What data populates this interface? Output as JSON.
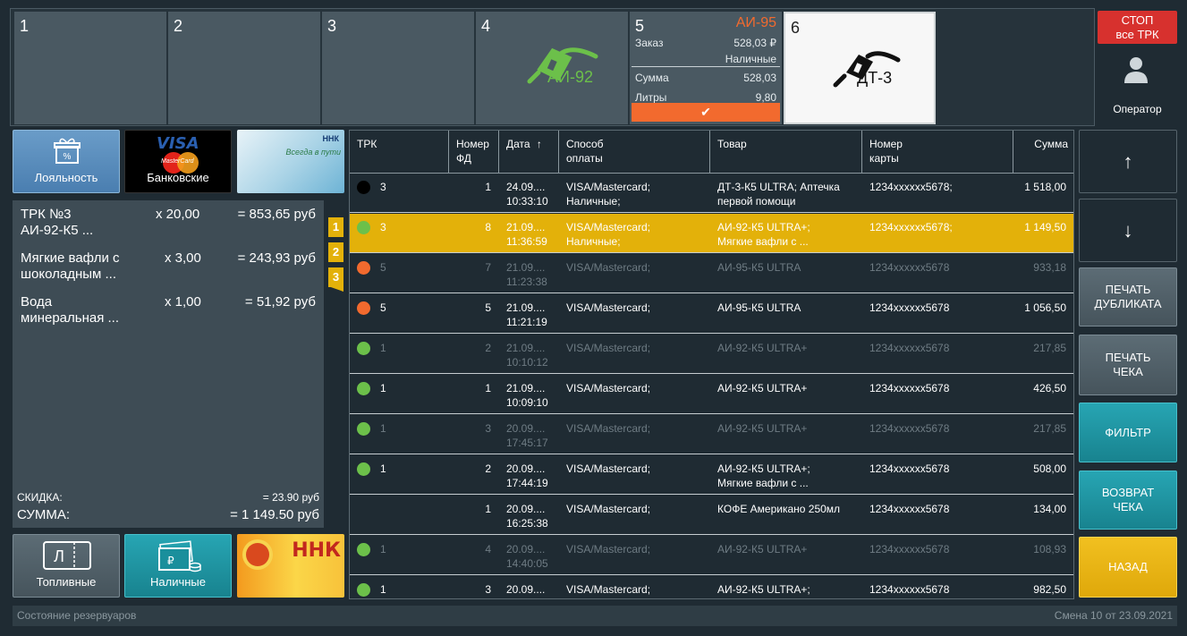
{
  "pumps": [
    {
      "num": "1"
    },
    {
      "num": "2"
    },
    {
      "num": "3"
    },
    {
      "num": "4",
      "fuel": "АИ-92"
    },
    {
      "num": "5",
      "fuel": "АИ-95",
      "order_label": "Заказ",
      "order_value": "528,03 ₽",
      "payment": "Наличные",
      "sum_label": "Сумма",
      "sum_value": "528,03",
      "liters_label": "Литры",
      "liters_value": "9,80",
      "ok": "✔"
    },
    {
      "num": "6",
      "fuel": "ДТ-3"
    }
  ],
  "stop_button": {
    "line1": "СТОП",
    "line2": "все ТРК"
  },
  "operator_label": "Оператор",
  "tiles": {
    "loyalty": "Лояльность",
    "bank": "Банковские",
    "bank_visa": "VISA",
    "bank_mc": "MasterCard",
    "fuel_cards": "Топливные",
    "cash": "Наличные",
    "nnk_brand": "ННК",
    "nnk_slogan": "Всегда в пути"
  },
  "order": {
    "items": [
      {
        "name1": "ТРК №3",
        "name2": "АИ-92-К5 ...",
        "qty": "x 20,00",
        "sum": "= 853,65 руб"
      },
      {
        "name1": "Мягкие вафли с",
        "name2": "шоколадным ...",
        "qty": "x 3,00",
        "sum": "= 243,93 руб"
      },
      {
        "name1": "Вода",
        "name2": "минеральная ...",
        "qty": "x 1,00",
        "sum": "= 51,92 руб"
      }
    ],
    "discount_label": "СКИДКА:",
    "discount_value": "= 23.90 руб",
    "total_label": "СУММА:",
    "total_value": "= 1 149.50 руб",
    "tags": [
      "1",
      "2",
      "3"
    ]
  },
  "table": {
    "headers": {
      "trk": "ТРК",
      "fd1": "Номер",
      "fd2": "ФД",
      "date": "Дата",
      "sort_icon": "↑",
      "pay1": "Способ",
      "pay2": "оплаты",
      "goods": "Товар",
      "card1": "Номер",
      "card2": "карты",
      "sum": "Сумма"
    },
    "rows": [
      {
        "dot": "black",
        "trk": "3",
        "fd": "1",
        "d1": "24.09....",
        "d2": "10:33:10",
        "p1": "VISA/Mastercard;",
        "p2": "Наличные;",
        "g1": "ДТ-3-К5 ULTRA; Аптечка",
        "g2": "первой помощи",
        "card": "1234xxxxxx5678;",
        "sum": "1 518,00",
        "state": "normal"
      },
      {
        "dot": "green",
        "trk": "3",
        "fd": "8",
        "d1": "21.09....",
        "d2": "11:36:59",
        "p1": "VISA/Mastercard;",
        "p2": "Наличные;",
        "g1": "АИ-92-К5 ULTRA+;",
        "g2": "Мягкие вафли с ...",
        "card": "1234xxxxxx5678;",
        "sum": "1 149,50",
        "state": "sel"
      },
      {
        "dot": "orange",
        "trk": "5",
        "fd": "7",
        "d1": "21.09....",
        "d2": "11:23:38",
        "p1": "VISA/Mastercard;",
        "p2": "",
        "g1": "АИ-95-К5 ULTRA",
        "g2": "",
        "card": "1234xxxxxx5678",
        "sum": "933,18",
        "state": "dim"
      },
      {
        "dot": "orange",
        "trk": "5",
        "fd": "5",
        "d1": "21.09....",
        "d2": "11:21:19",
        "p1": "VISA/Mastercard;",
        "p2": "",
        "g1": "АИ-95-К5 ULTRA",
        "g2": "",
        "card": "1234xxxxxx5678",
        "sum": "1 056,50",
        "state": "normal"
      },
      {
        "dot": "green",
        "trk": "1",
        "fd": "2",
        "d1": "21.09....",
        "d2": "10:10:12",
        "p1": "VISA/Mastercard;",
        "p2": "",
        "g1": "АИ-92-К5 ULTRA+",
        "g2": "",
        "card": "1234xxxxxx5678",
        "sum": "217,85",
        "state": "dim"
      },
      {
        "dot": "green",
        "trk": "1",
        "fd": "1",
        "d1": "21.09....",
        "d2": "10:09:10",
        "p1": "VISA/Mastercard;",
        "p2": "",
        "g1": "АИ-92-К5 ULTRA+",
        "g2": "",
        "card": "1234xxxxxx5678",
        "sum": "426,50",
        "state": "normal"
      },
      {
        "dot": "green",
        "trk": "1",
        "fd": "3",
        "d1": "20.09....",
        "d2": "17:45:17",
        "p1": "VISA/Mastercard;",
        "p2": "",
        "g1": "АИ-92-К5 ULTRA+",
        "g2": "",
        "card": "1234xxxxxx5678",
        "sum": "217,85",
        "state": "dim"
      },
      {
        "dot": "green",
        "trk": "1",
        "fd": "2",
        "d1": "20.09....",
        "d2": "17:44:19",
        "p1": "VISA/Mastercard;",
        "p2": "",
        "g1": "АИ-92-К5 ULTRA+;",
        "g2": "Мягкие вафли с ...",
        "card": "1234xxxxxx5678",
        "sum": "508,00",
        "state": "normal"
      },
      {
        "dot": "",
        "trk": "",
        "fd": "1",
        "d1": "20.09....",
        "d2": "16:25:38",
        "p1": "VISA/Mastercard;",
        "p2": "",
        "g1": "КОФЕ Американо 250мл",
        "g2": "",
        "card": "1234xxxxxx5678",
        "sum": "134,00",
        "state": "normal"
      },
      {
        "dot": "green",
        "trk": "1",
        "fd": "4",
        "d1": "20.09....",
        "d2": "14:40:05",
        "p1": "VISA/Mastercard;",
        "p2": "",
        "g1": "АИ-92-К5 ULTRA+",
        "g2": "",
        "card": "1234xxxxxx5678",
        "sum": "108,93",
        "state": "dim"
      },
      {
        "dot": "green",
        "trk": "1",
        "fd": "3",
        "d1": "20.09....",
        "d2": "",
        "p1": "VISA/Mastercard;",
        "p2": "",
        "g1": "АИ-92-К5 ULTRA+;",
        "g2": "",
        "card": "1234xxxxxx5678",
        "sum": "982,50",
        "state": "normal"
      }
    ]
  },
  "right_buttons": {
    "up": "↑",
    "down": "↓",
    "dup1": "ПЕЧАТЬ",
    "dup2": "ДУБЛИКАТА",
    "print1": "ПЕЧАТЬ",
    "print2": "ЧЕКА",
    "filter": "ФИЛЬТР",
    "ret1": "ВОЗВРАТ",
    "ret2": "ЧЕКА",
    "back": "НАЗАД"
  },
  "status": {
    "left": "Состояние резервуаров",
    "right": "Смена 10 от 23.09.2021"
  },
  "colors": {
    "accent_orange": "#f26a2e",
    "selected_row": "#e3b10a",
    "green": "#6cc04a",
    "stop_red": "#d7312e"
  }
}
